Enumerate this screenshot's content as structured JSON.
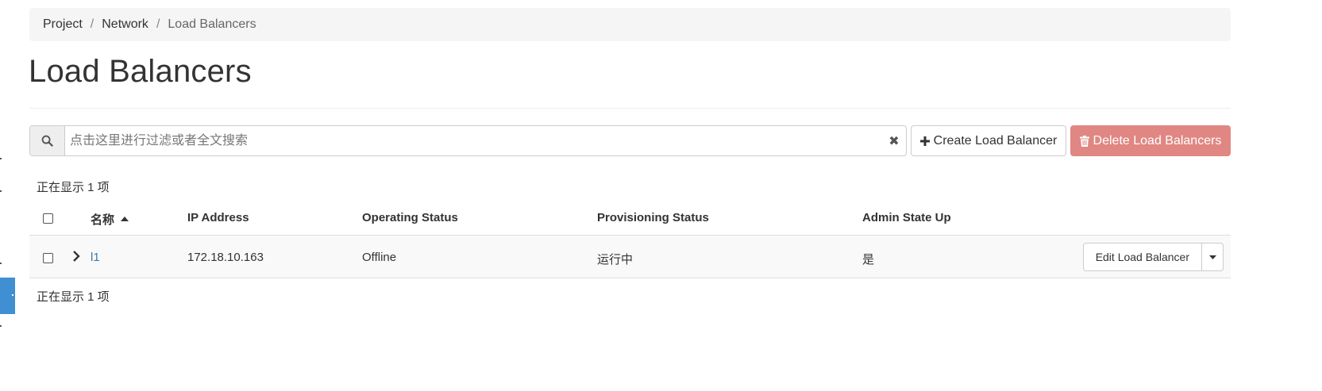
{
  "breadcrumb": {
    "items": [
      "Project",
      "Network",
      "Load Balancers"
    ],
    "separator": "/"
  },
  "page_title": "Load Balancers",
  "search": {
    "placeholder": "点击这里进行过滤或者全文搜索",
    "value": "",
    "icon": "search-icon",
    "clear_icon": "close-icon",
    "clear_label": "✖"
  },
  "actions": {
    "create_label": "Create Load Balancer",
    "create_icon": "plus-icon",
    "delete_label": "Delete Load Balancers",
    "delete_icon": "trash-icon",
    "delete_color": "#e08783"
  },
  "count_top": "正在显示 1 项",
  "count_bottom": "正在显示 1 项",
  "table": {
    "columns": [
      "名称",
      "IP Address",
      "Operating Status",
      "Provisioning Status",
      "Admin State Up"
    ],
    "sort_column": "名称",
    "sort_direction": "asc",
    "rows": [
      {
        "name": "l1",
        "ip": "172.18.10.163",
        "operating_status": "Offline",
        "provisioning_status": "运行中",
        "admin_state_up": "是",
        "action_label": "Edit Load Balancer"
      }
    ]
  },
  "colors": {
    "link": "#337ab7",
    "sidebar_active": "#3f8fd2",
    "breadcrumb_bg": "#f5f5f5"
  }
}
